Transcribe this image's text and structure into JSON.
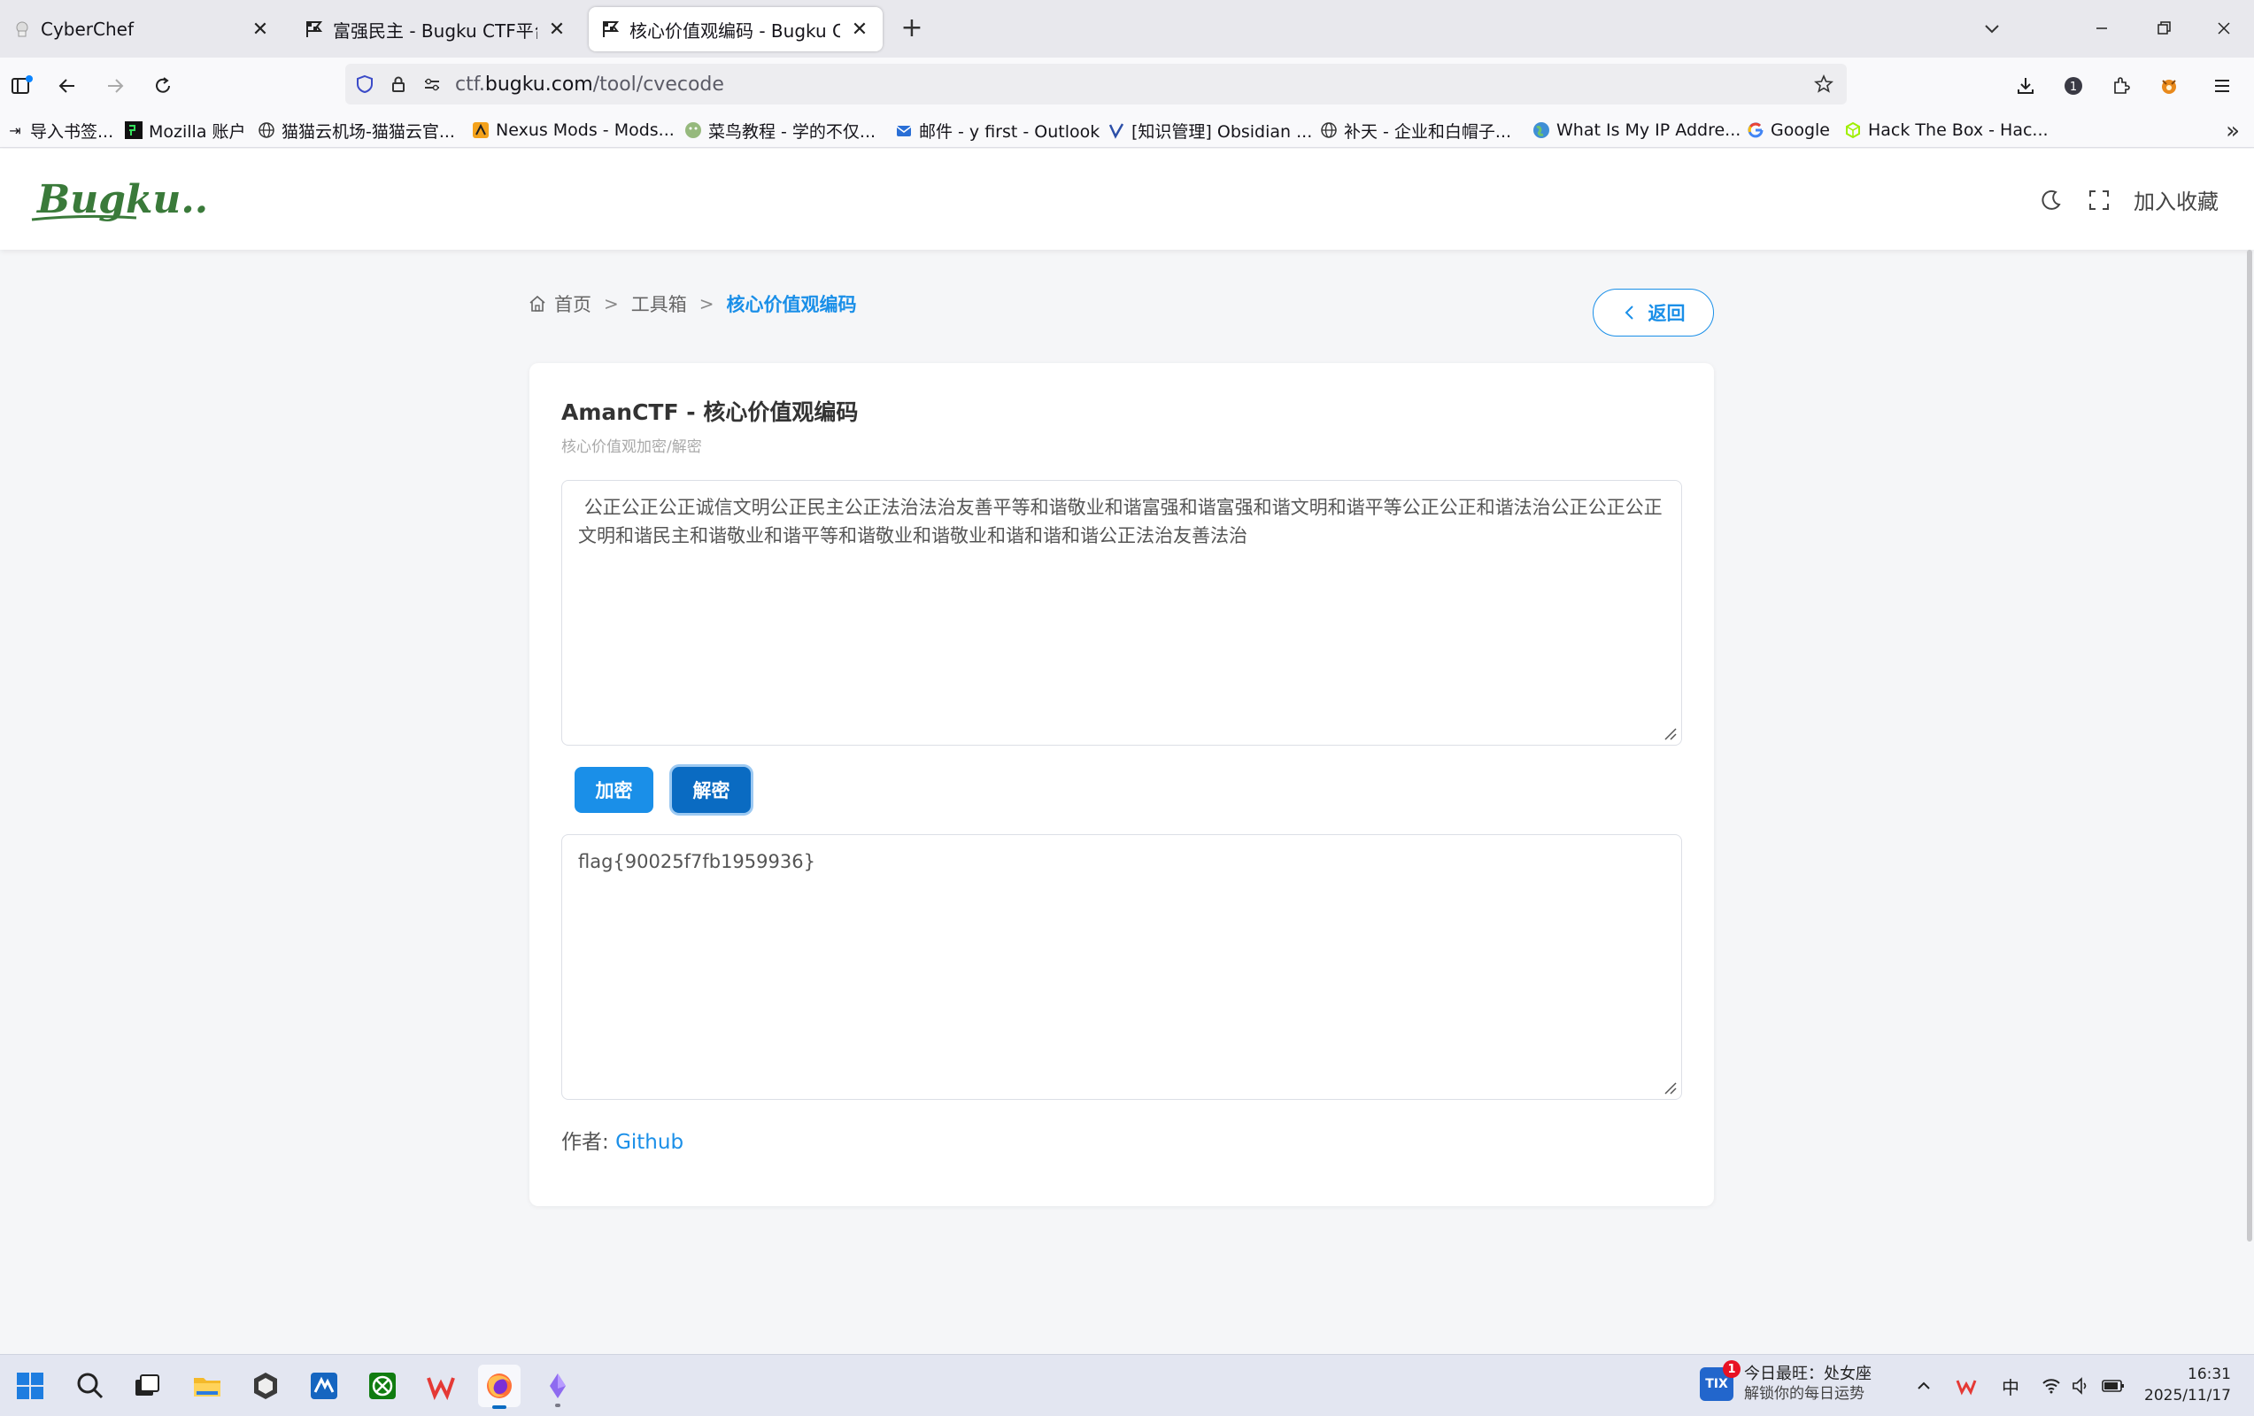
{
  "tabs": [
    {
      "title": "CyberChef",
      "icon": "chef-icon"
    },
    {
      "title": "富强民主 - Bugku CTF平台",
      "icon": "flag-icon"
    },
    {
      "title": "核心价值观编码 - Bugku CTF平台",
      "icon": "flag-icon"
    }
  ],
  "url": {
    "prefix": "ctf.",
    "domain": "bugku.com",
    "path": "/tool/cvecode"
  },
  "bookmarks": [
    "导入书签...",
    "Mozilla 账户",
    "猫猫云机场-猫猫云官...",
    "Nexus Mods - Mods...",
    "菜鸟教程 - 学的不仅...",
    "邮件 - y first - Outlook",
    "[知识管理] Obsidian ...",
    "补天 - 企业和白帽子...",
    "What Is My IP Addre...",
    "Google",
    "Hack The Box - Hac..."
  ],
  "header": {
    "logo_text": "Bugku...",
    "favorite_label": "加入收藏"
  },
  "breadcrumb": {
    "home": "首页",
    "toolbox": "工具箱",
    "current": "核心价值观编码"
  },
  "back_label": "返回",
  "card": {
    "title": "AmanCTF - 核心价值观编码",
    "subtitle": "核心价值观加密/解密",
    "input_text": " 公正公正公正诚信文明公正民主公正法治法治友善平等和谐敬业和谐富强和谐富强和谐文明和谐平等公正公正和谐法治公正公正公正文明和谐民主和谐敬业和谐平等和谐敬业和谐敬业和谐和谐和谐公正法治友善法治",
    "encrypt_label": "加密",
    "decrypt_label": "解密",
    "output_text": "flag{90025f7fb1959936}",
    "author_label": "作者: ",
    "author_link": "Github"
  },
  "taskbar": {
    "notification_badge": "1",
    "notification_title": "今日最旺：处女座",
    "notification_subtitle": "解锁你的每日运势",
    "ime": "中",
    "time": "16:31",
    "date": "2025/11/17"
  },
  "colors": {
    "accent": "#1a8fe8",
    "accent_dark": "#0a6bc2",
    "page_bg": "#f5f6f8"
  }
}
